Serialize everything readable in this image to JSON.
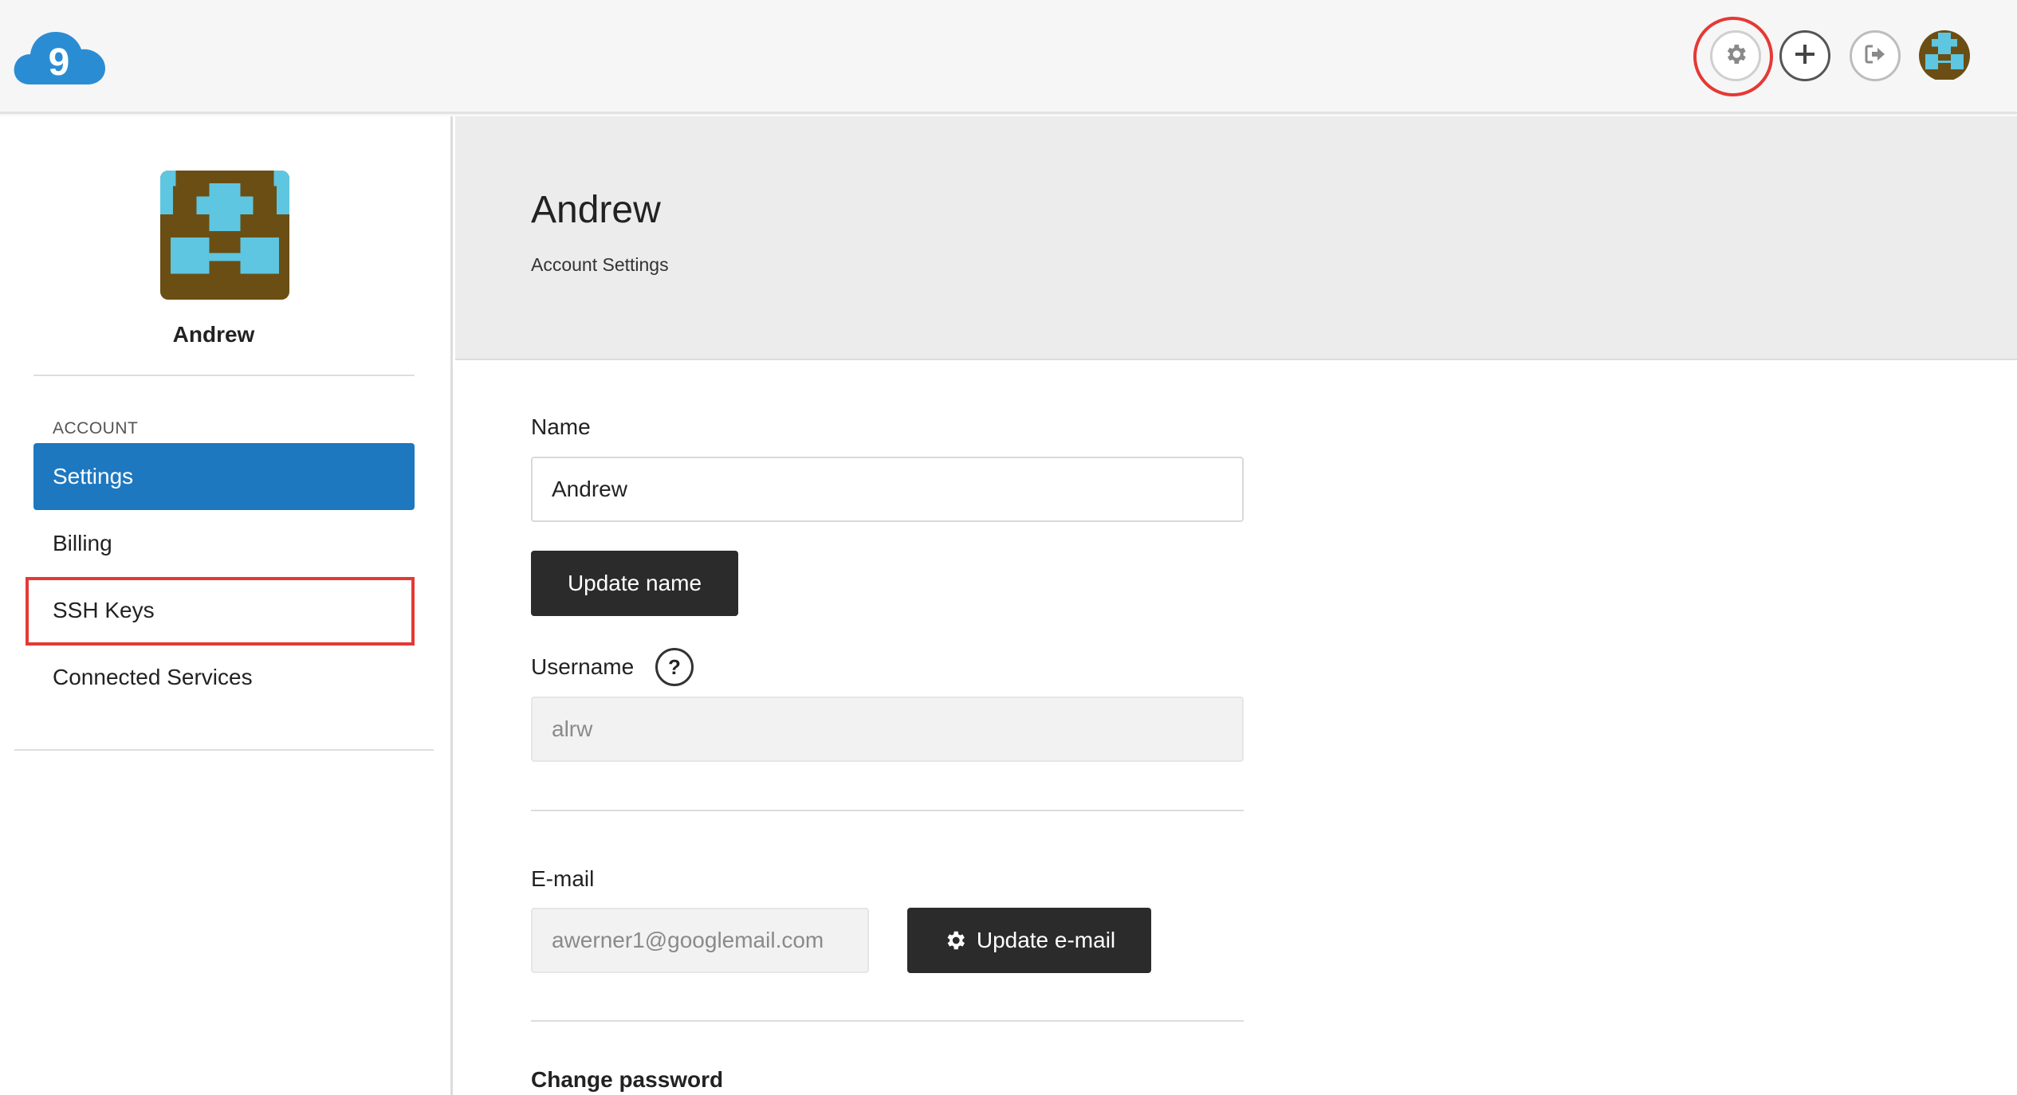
{
  "header": {
    "logo_icon": "cloud9-logo",
    "logo_text": "9",
    "buttons": [
      {
        "name": "settings",
        "icon": "gear-icon",
        "highlighted": true
      },
      {
        "name": "add",
        "icon": "plus-icon",
        "glyph": "+"
      },
      {
        "name": "logout",
        "icon": "logout-icon"
      },
      {
        "name": "user-avatar",
        "icon": "avatar"
      }
    ]
  },
  "sidebar": {
    "user_name": "Andrew",
    "section_label": "ACCOUNT",
    "items": [
      {
        "label": "Settings",
        "active": true
      },
      {
        "label": "Billing",
        "active": false
      },
      {
        "label": "SSH Keys",
        "active": false,
        "highlighted": true
      },
      {
        "label": "Connected Services",
        "active": false
      }
    ]
  },
  "hero": {
    "title": "Andrew",
    "subtitle": "Account Settings"
  },
  "form": {
    "name_label": "Name",
    "name_value": "Andrew",
    "update_name_button": "Update name",
    "username_label": "Username",
    "help_glyph": "?",
    "username_value": "alrw",
    "email_label": "E-mail",
    "email_value": "awerner1@googlemail.com",
    "update_email_button": "Update e-mail",
    "change_password_label": "Change password"
  },
  "colors": {
    "accent": "#1e78bf",
    "highlight": "#e53935",
    "avatar_bg": "#6b4e14",
    "avatar_fg": "#5ec6e0",
    "dark_button": "#2b2b2b"
  }
}
